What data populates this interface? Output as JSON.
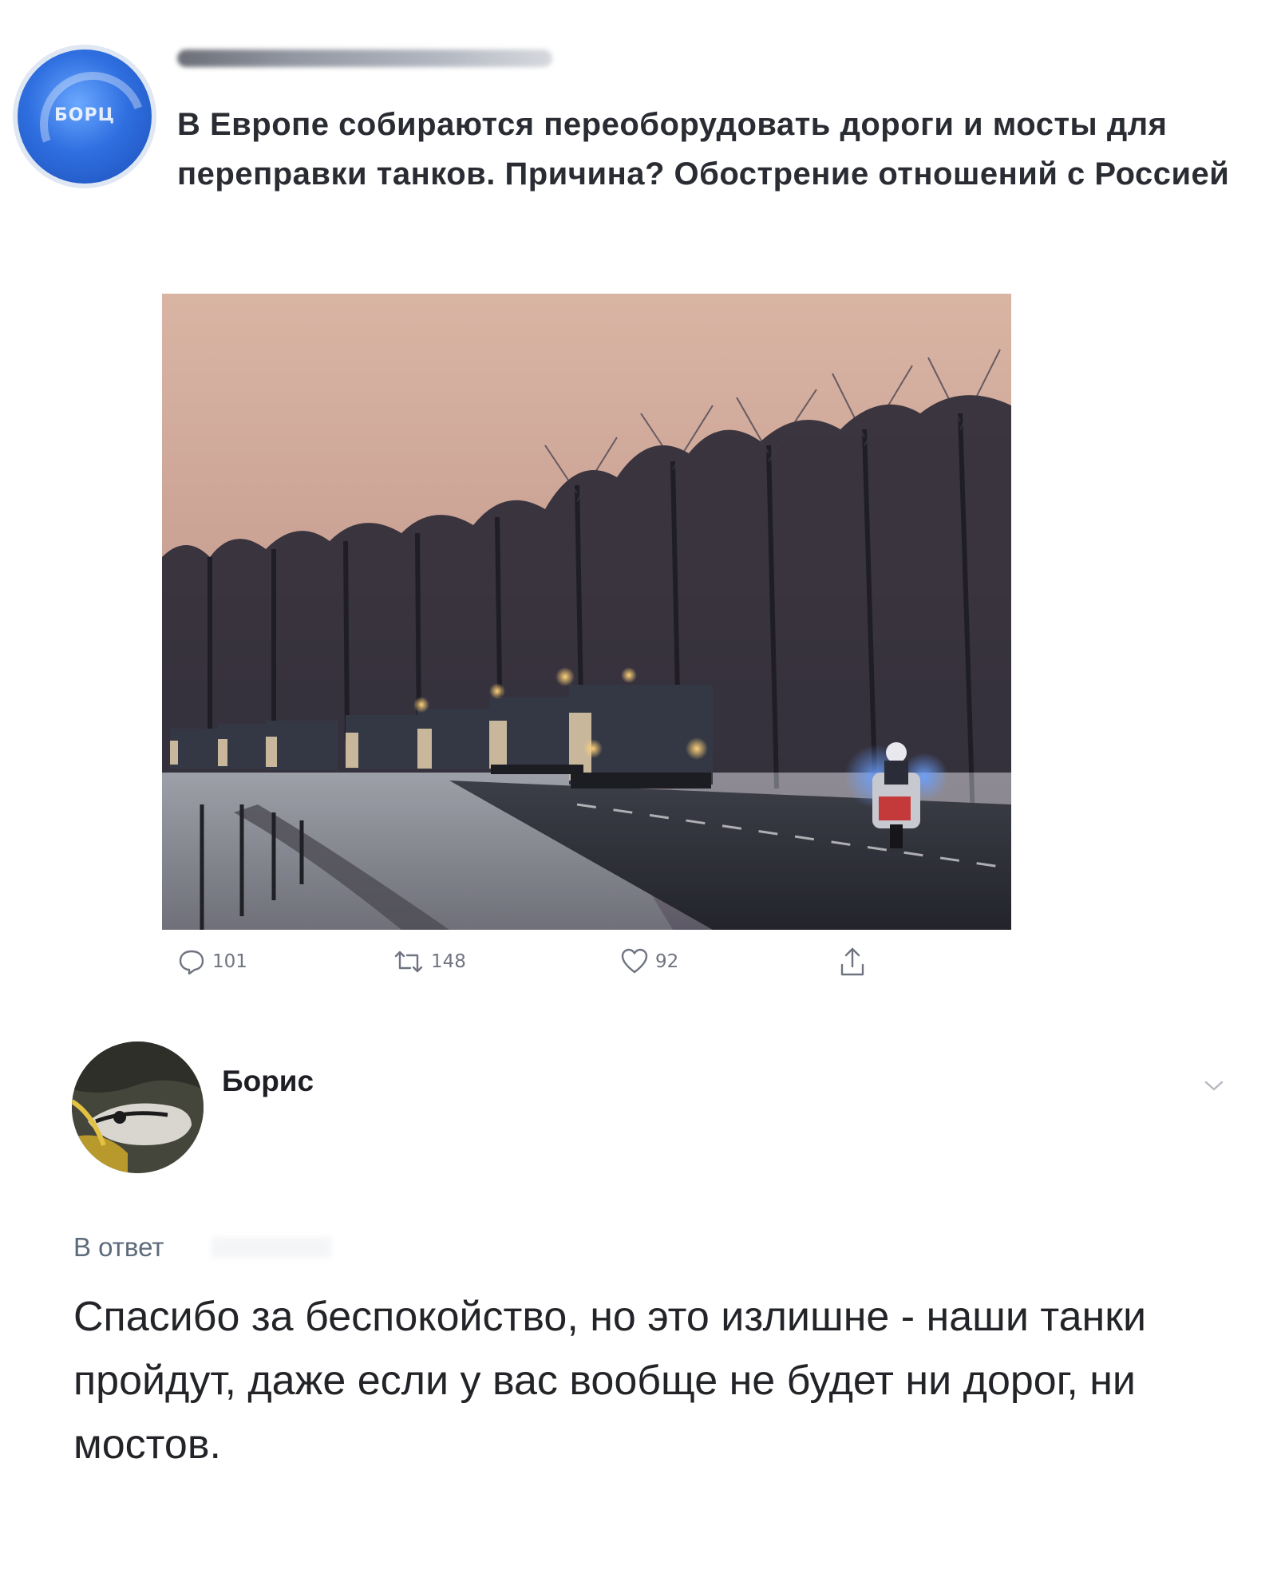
{
  "post": {
    "avatar_label": "БОРЦ",
    "avatar_icon": "brand-logo",
    "text": "В Европе собираются переоборудовать дороги и мосты для переправки танков. Причина? Обострение отношений с Россией",
    "image_alt": "Колонна бронетехники на дороге среди деревьев на рассвете, впереди полицейский мотоцикл",
    "stats": {
      "replies": "101",
      "retweets": "148",
      "likes": "92"
    },
    "icons": {
      "reply": "reply-icon",
      "retweet": "retweet-icon",
      "like": "heart-icon",
      "share": "share-icon"
    }
  },
  "reply": {
    "author": "Борис",
    "in_reply_to_label": "В ответ",
    "text": "Спасибо за беспокойство, но это излишне - наши танки пройдут, даже если у вас вообще не будет ни дорог, ни мостов.",
    "menu_icon": "chevron-down-icon"
  },
  "colors": {
    "icon_gray": "#6f7480",
    "link_gray": "#5d6b7c",
    "avatar_blue": "#2f6fe0"
  }
}
